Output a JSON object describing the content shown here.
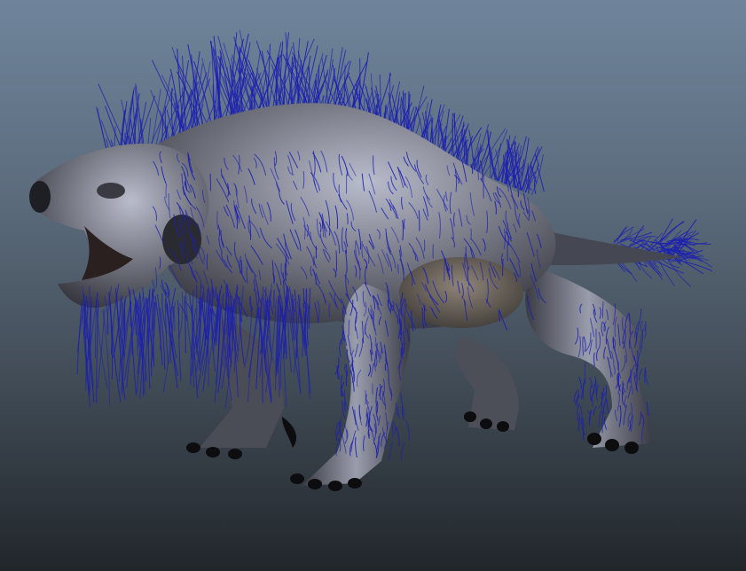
{
  "viewport": {
    "background_top": "#6f849b",
    "background_bottom": "#21262b"
  },
  "creature": {
    "skin_color": "#6d6f78",
    "skin_highlight": "#b9bccb",
    "skin_shadow": "#2b2c33",
    "claw_color": "#0d0d10",
    "fur_guide_color": "#1c1fb0"
  }
}
